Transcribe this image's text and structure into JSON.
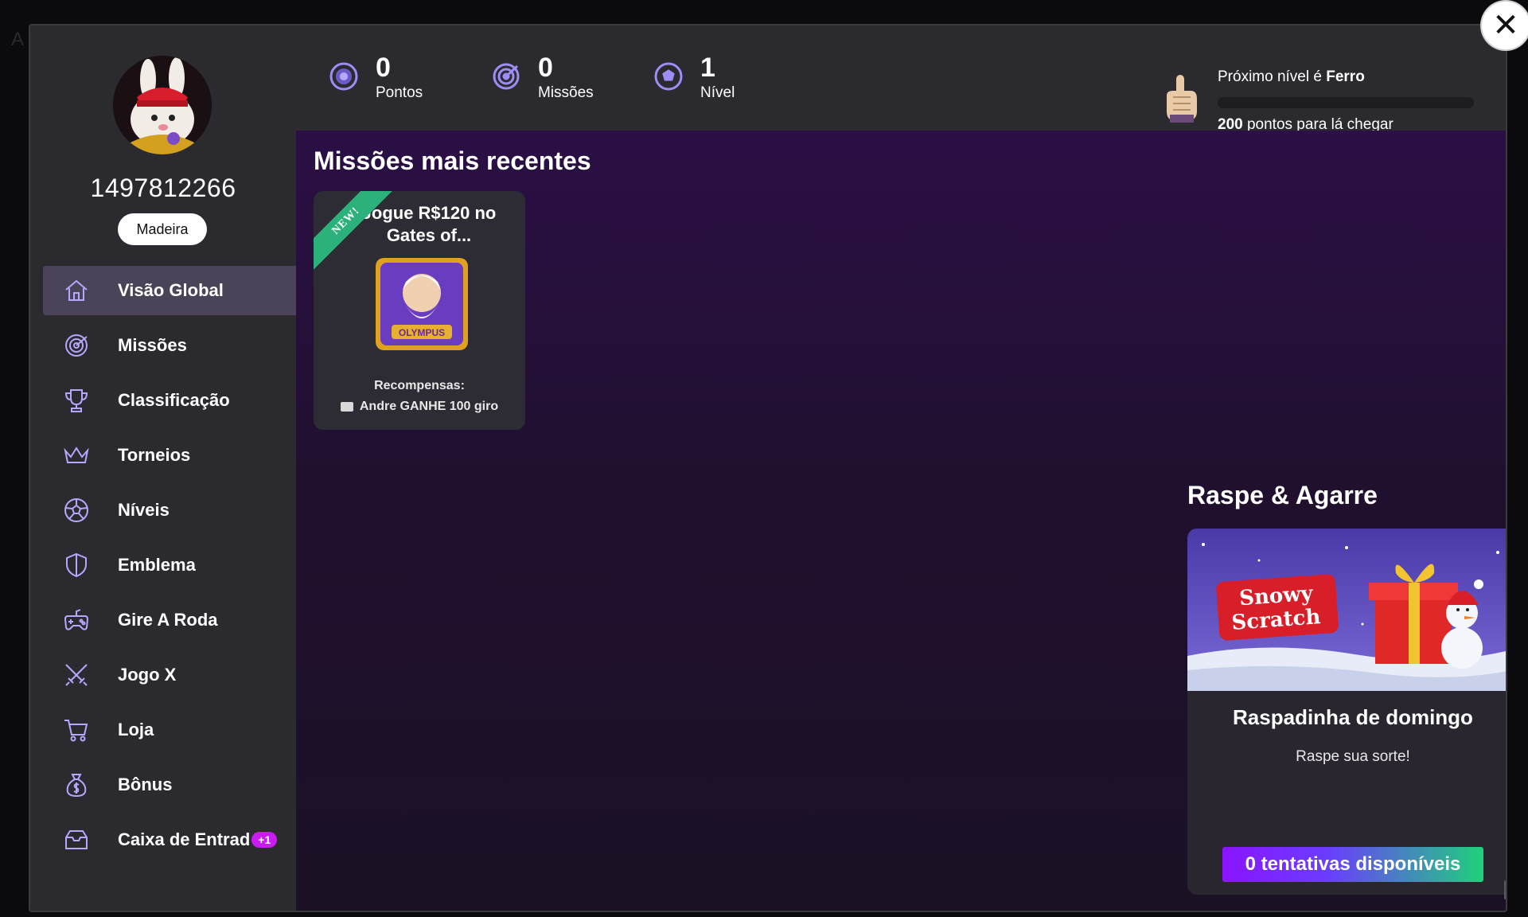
{
  "backdrop": {
    "letter": "A"
  },
  "close": {
    "glyph": "✕"
  },
  "profile": {
    "user_id": "1497812266",
    "rank": "Madeira"
  },
  "nav": {
    "items": [
      {
        "label": "Visão Global",
        "icon": "home-icon"
      },
      {
        "label": "Missões",
        "icon": "target-icon"
      },
      {
        "label": "Classificação",
        "icon": "trophy-icon"
      },
      {
        "label": "Torneios",
        "icon": "crown-icon"
      },
      {
        "label": "Níveis",
        "icon": "levels-ball-icon"
      },
      {
        "label": "Emblema",
        "icon": "shield-icon"
      },
      {
        "label": "Gire A Roda",
        "icon": "gamepad-icon"
      },
      {
        "label": "Jogo X",
        "icon": "crossed-swords-icon"
      },
      {
        "label": "Loja",
        "icon": "cart-icon"
      },
      {
        "label": "Bônus",
        "icon": "money-bag-icon"
      },
      {
        "label": "Caixa de Entrad",
        "icon": "inbox-icon",
        "badge": "+1"
      }
    ],
    "active_index": 0
  },
  "stats": {
    "points": {
      "value": "0",
      "label": "Pontos"
    },
    "missions": {
      "value": "0",
      "label": "Missões"
    },
    "level": {
      "value": "1",
      "label": "Nível"
    }
  },
  "level_progress": {
    "next_prefix": "Próximo nível é",
    "next_level": "Ferro",
    "points_needed": "200",
    "points_suffix": "pontos para lá chegar",
    "progress_fraction": 0
  },
  "recent_missions": {
    "title": "Missões mais recentes",
    "cards": [
      {
        "ribbon": "NEW!",
        "title": "Jogue R$120 no Gates of...",
        "rewards_label": "Recompensas:",
        "reward": "Andre GANHE 100 giro",
        "game_label": "OLYMPUS"
      }
    ]
  },
  "scratch": {
    "title": "Raspe & Agarre",
    "card_name": "Raspadinha de domingo",
    "card_desc": "Raspe sua sorte!",
    "image_text_line1": "Snowy",
    "image_text_line2": "Scratch",
    "attempts_label": "0 tentativas disponíveis"
  },
  "colors": {
    "accent_purple": "#8a14ff",
    "accent_green": "#1fd17a",
    "ribbon_green": "#2db17b",
    "badge_magenta": "#c81cf0",
    "active_nav": "#4b4358"
  }
}
